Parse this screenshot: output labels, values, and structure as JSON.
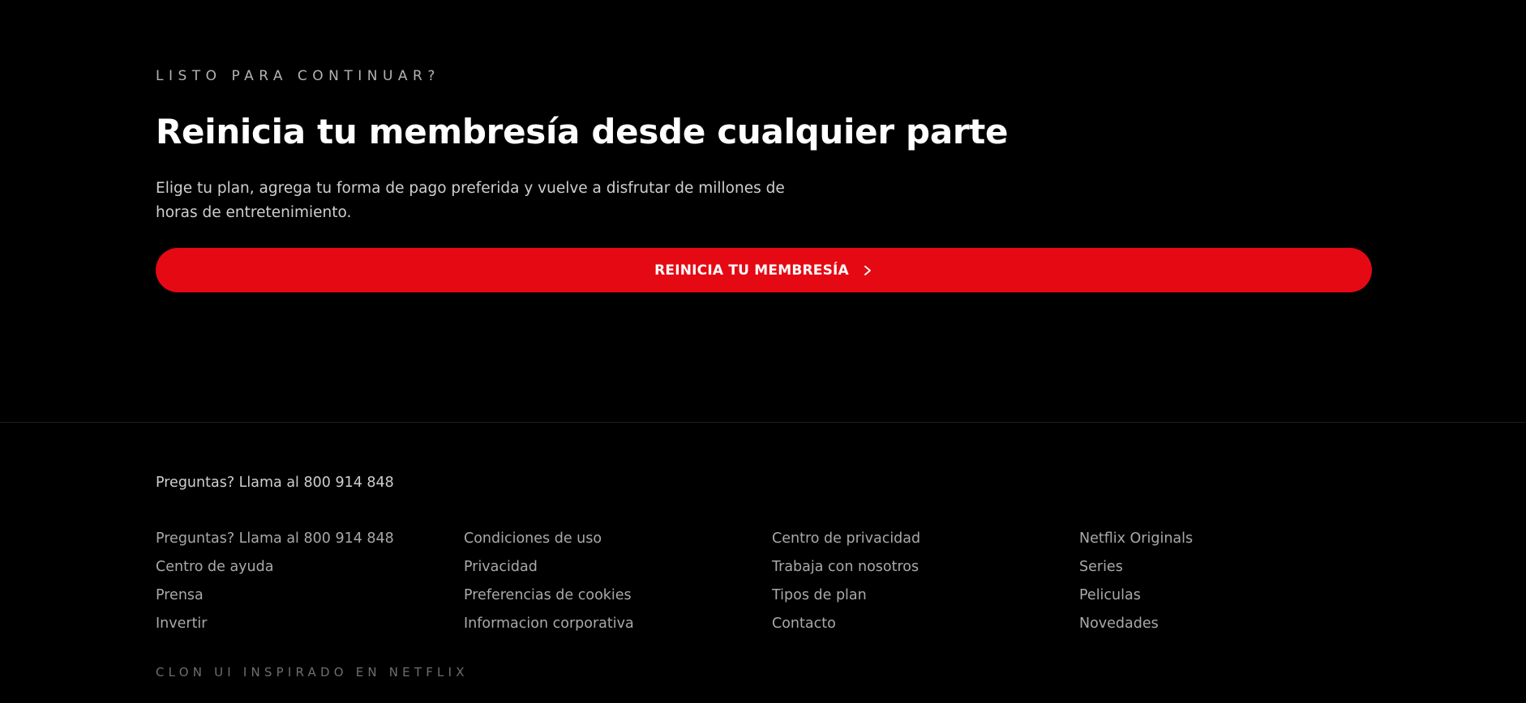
{
  "hero": {
    "eyebrow": "LISTO PARA CONTINUAR?",
    "headline": "Reinicia tu membresía desde cualquier parte",
    "subtext": "Elige tu plan, agrega tu forma de pago preferida y vuelve a disfrutar de millones de horas de entretenimiento.",
    "cta_label": "REINICIA TU MEMBRESÍA",
    "cta_icon": "chevron-right-icon"
  },
  "footer": {
    "phone": "Preguntas? Llama al 800 914 848",
    "columns": [
      [
        "Preguntas? Llama al 800 914 848",
        "Centro de ayuda",
        "Prensa",
        "Invertir"
      ],
      [
        "Condiciones de uso",
        "Privacidad",
        "Preferencias de cookies",
        "Informacion corporativa"
      ],
      [
        "Centro de privacidad",
        "Trabaja con nosotros",
        "Tipos de plan",
        "Contacto"
      ],
      [
        "Netflix Originals",
        "Series",
        "Peliculas",
        "Novedades"
      ]
    ],
    "credit": "CLON UI INSPIRADO EN NETFLIX"
  },
  "colors": {
    "background": "#000000",
    "accent_red": "#e50914",
    "text_primary": "#ffffff",
    "text_secondary": "#cfcfcf",
    "text_muted": "#a9a9a9",
    "text_faint": "#6e6e6e"
  }
}
